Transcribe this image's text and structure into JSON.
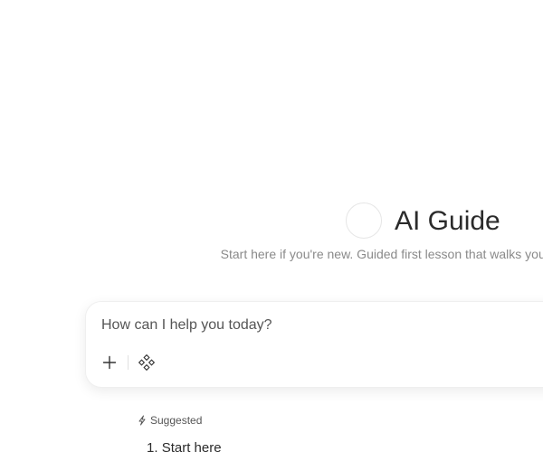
{
  "agent": {
    "name": "AI Guide",
    "description": "Start here if you're new. Guided first lesson that walks you through step."
  },
  "composer": {
    "placeholder": "How can I help you today?",
    "add_icon": "plus-icon",
    "skills_icon": "diamond-cluster-icon"
  },
  "suggested": {
    "label": "Suggested",
    "icon": "sparkle-icon",
    "items": [
      {
        "number": "1.",
        "label": "Start here"
      }
    ]
  }
}
